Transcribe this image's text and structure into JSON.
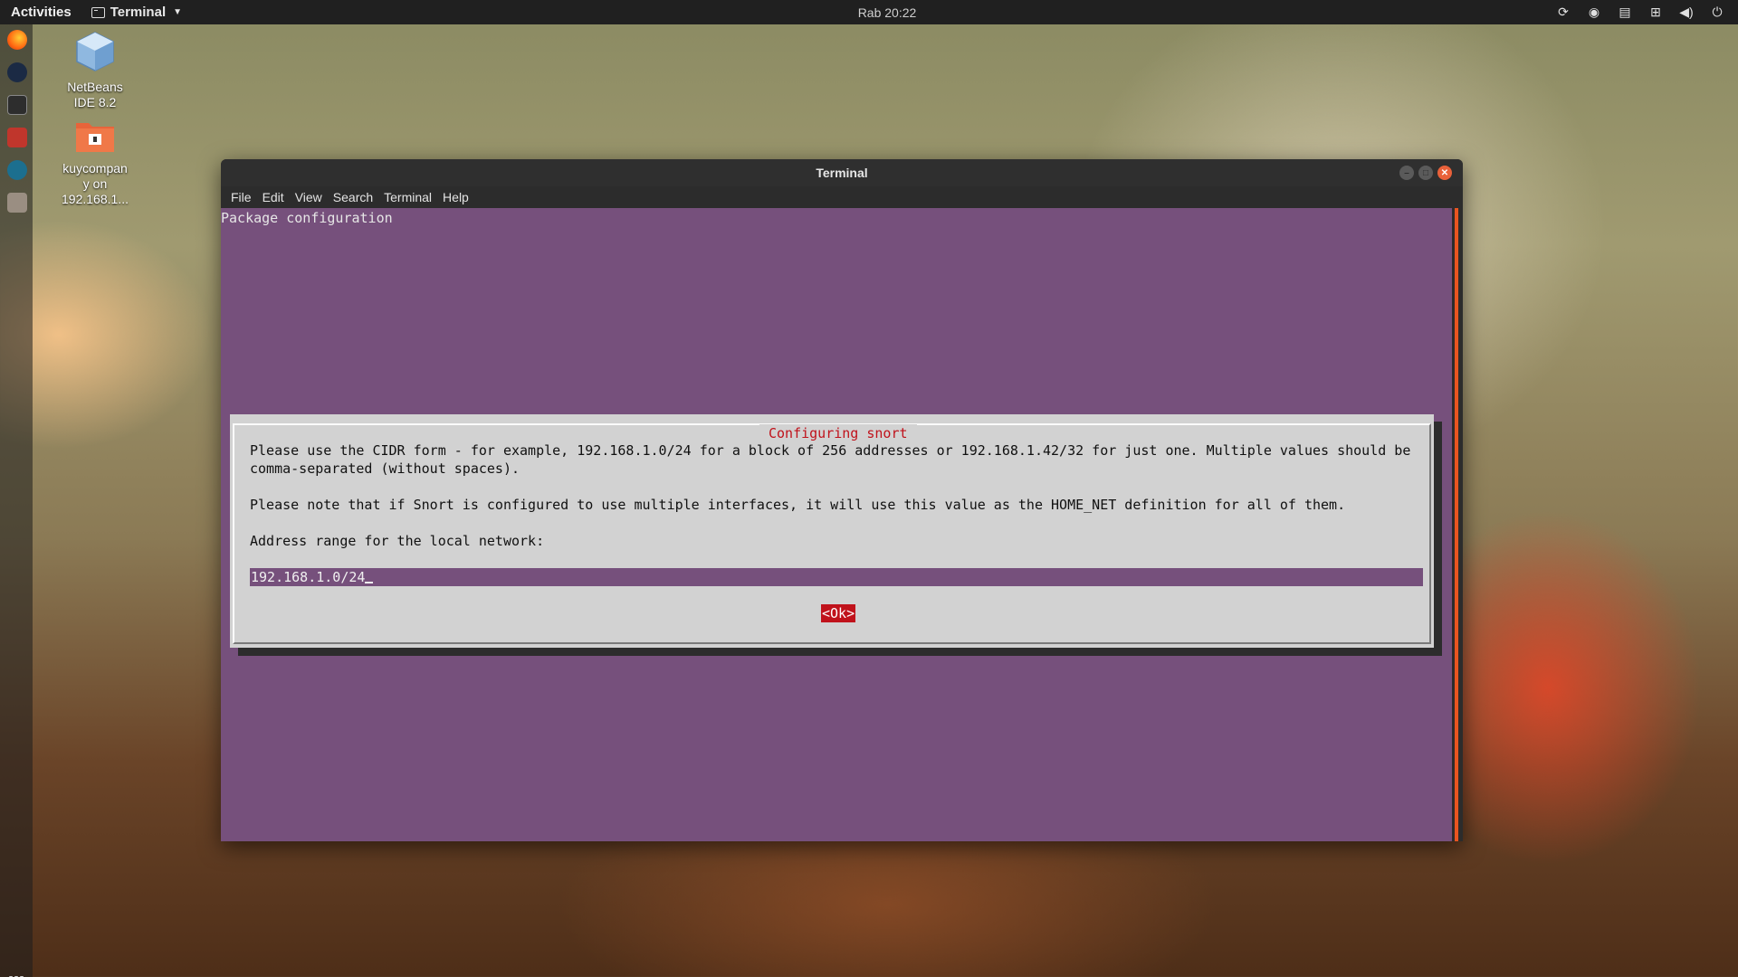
{
  "topbar": {
    "activities": "Activities",
    "app_name": "Terminal",
    "clock": "Rab 20:22",
    "tray_icons": [
      "steam-sync-icon",
      "steam-icon",
      "clipboard-icon",
      "network-icon",
      "volume-icon",
      "power-icon"
    ]
  },
  "dock": {
    "items": [
      "firefox-icon",
      "steam-icon",
      "terminal-icon",
      "software-icon",
      "app-icon",
      "files-icon"
    ],
    "show_apps": "show-applications-icon"
  },
  "desktop": {
    "icons": [
      {
        "label": "NetBeans IDE 8.2",
        "line1": "NetBeans",
        "line2": "IDE 8.2",
        "icon": "netbeans-icon"
      },
      {
        "label": "kuycompany on 192.168.1...",
        "line1": "kuycompan",
        "line2": "y on",
        "line3": "192.168.1...",
        "icon": "network-folder-icon"
      }
    ]
  },
  "window": {
    "title": "Terminal",
    "menu": [
      "File",
      "Edit",
      "View",
      "Search",
      "Terminal",
      "Help"
    ],
    "package_configuration": "Package configuration",
    "colors": {
      "terminal_bg": "#76507c",
      "dialog_bg": "#d2d2d2",
      "accent": "#c0121b",
      "ubuntu_orange": "#e95420"
    }
  },
  "dialog": {
    "title": "Configuring snort",
    "line1": "Please use the CIDR form - for example, 192.168.1.0/24 for a block of 256 addresses or 192.168.1.42/32 for just one. Multiple values should be",
    "line2": "comma-separated (without spaces).",
    "line3": "Please note that if Snort is configured to use multiple interfaces, it will use this value as the HOME_NET definition for all of them.",
    "line4": "Address range for the local network:",
    "input_value": "192.168.1.0/24",
    "ok_label": "<Ok>"
  }
}
